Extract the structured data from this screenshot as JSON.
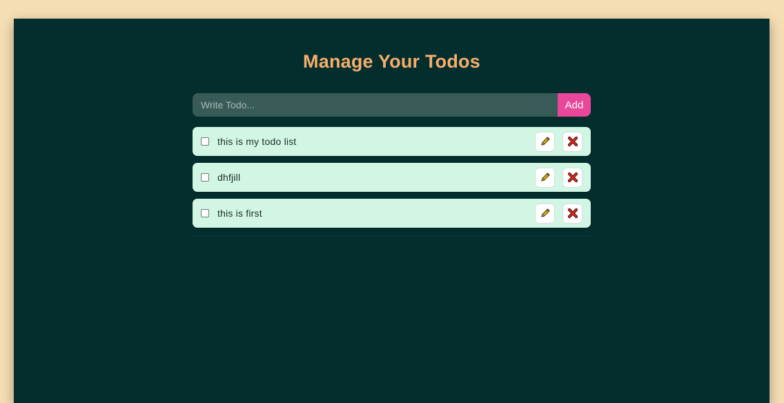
{
  "header": {
    "title": "Manage Your Todos"
  },
  "add_form": {
    "placeholder": "Write Todo...",
    "value": "",
    "add_label": "Add"
  },
  "todos": [
    {
      "text": "this is my todo list",
      "completed": false
    },
    {
      "text": "dhfjill",
      "completed": false
    },
    {
      "text": "this is first",
      "completed": false
    }
  ],
  "icons": {
    "edit": "pencil-icon",
    "delete": "cross-icon"
  },
  "colors": {
    "page_background": "#f5deb3",
    "panel_background": "#042e2e",
    "title": "#f6ae6b",
    "input_background": "#395b57",
    "add_button": "#e8479a",
    "todo_background": "#d1f7e4",
    "delete_icon": "#c0241f"
  }
}
